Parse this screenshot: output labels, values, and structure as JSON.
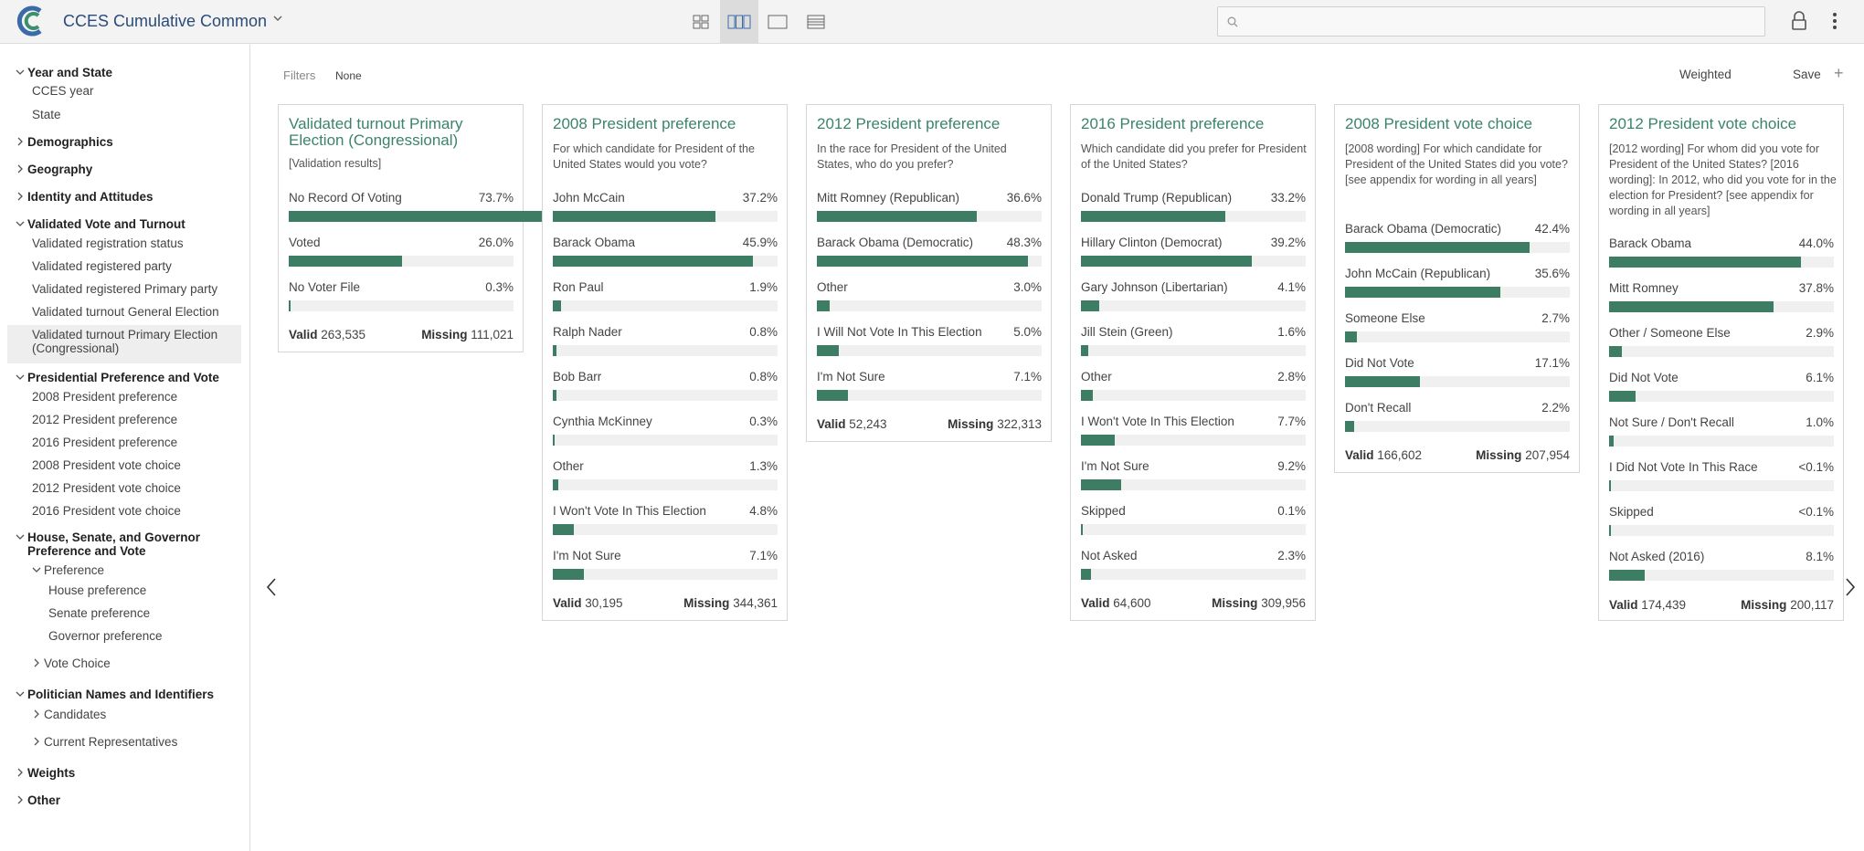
{
  "app": {
    "title": "CCES Cumulative Common"
  },
  "search": {
    "placeholder": ""
  },
  "sidebar": {
    "rows": [
      {
        "label": "Year and State",
        "kind": "group",
        "open": true
      },
      {
        "label": "CCES year",
        "kind": "leaf"
      },
      {
        "label": "State",
        "kind": "leaf"
      },
      {
        "label": "Demographics",
        "kind": "group",
        "open": false
      },
      {
        "label": "Geography",
        "kind": "group",
        "open": false
      },
      {
        "label": "Identity and Attitudes",
        "kind": "group",
        "open": false
      },
      {
        "label": "Validated Vote and Turnout",
        "kind": "group",
        "open": true
      },
      {
        "label": "Validated registration status",
        "kind": "leaf"
      },
      {
        "label": "Validated registered party",
        "kind": "leaf"
      },
      {
        "label": "Validated registered Primary party",
        "kind": "leaf"
      },
      {
        "label": "Validated turnout General Election",
        "kind": "leaf"
      },
      {
        "label": "Validated turnout Primary Election (Congressional)",
        "kind": "leaf",
        "selected": true
      },
      {
        "label": "Presidential Preference and Vote",
        "kind": "group",
        "open": true
      },
      {
        "label": "2008 President preference",
        "kind": "leaf"
      },
      {
        "label": "2012 President preference",
        "kind": "leaf"
      },
      {
        "label": "2016 President preference",
        "kind": "leaf"
      },
      {
        "label": "2008 President vote choice",
        "kind": "leaf"
      },
      {
        "label": "2012 President vote choice",
        "kind": "leaf"
      },
      {
        "label": "2016 President vote choice",
        "kind": "leaf"
      },
      {
        "label": "House, Senate, and Governor Preference and Vote",
        "kind": "group",
        "open": true
      },
      {
        "label": "Preference",
        "kind": "subgroup",
        "open": true
      },
      {
        "label": "House preference",
        "kind": "subleaf"
      },
      {
        "label": "Senate preference",
        "kind": "subleaf"
      },
      {
        "label": "Governor preference",
        "kind": "subleaf"
      },
      {
        "label": "Vote Choice",
        "kind": "subgroup",
        "open": false
      },
      {
        "label": "Politician Names and Identifiers",
        "kind": "group",
        "open": true
      },
      {
        "label": "Candidates",
        "kind": "subgroup",
        "open": false
      },
      {
        "label": "Current Representatives",
        "kind": "subgroup",
        "open": false
      },
      {
        "label": "Weights",
        "kind": "group",
        "open": false
      },
      {
        "label": "Other",
        "kind": "group",
        "open": false
      }
    ]
  },
  "toolbar": {
    "filters_label": "Filters",
    "filters_value": "None",
    "weighted_label": "Weighted",
    "save_label": "Save",
    "add_symbol": "+"
  },
  "colors": {
    "bar": "#3c7d63",
    "title": "#3b8469",
    "track": "#f0f0f0"
  },
  "cards": [
    {
      "title": "Validated turnout Primary Election (Congressional)",
      "subtitle": "[Validation results]",
      "categories": [
        {
          "label": "No Record Of Voting",
          "pct": "73.7%",
          "value": 73.7
        },
        {
          "label": "Voted",
          "pct": "26.0%",
          "value": 26.0
        },
        {
          "label": "No Voter File",
          "pct": "0.3%",
          "value": 0.3
        }
      ],
      "valid_label": "Valid",
      "valid": "263,535",
      "missing_label": "Missing",
      "missing": "111,021"
    },
    {
      "title": "2008 President preference",
      "subtitle": "For which candidate for President of the United States would you vote?",
      "categories": [
        {
          "label": "John McCain",
          "pct": "37.2%",
          "value": 37.2
        },
        {
          "label": "Barack Obama",
          "pct": "45.9%",
          "value": 45.9
        },
        {
          "label": "Ron Paul",
          "pct": "1.9%",
          "value": 1.9
        },
        {
          "label": "Ralph Nader",
          "pct": "0.8%",
          "value": 0.8
        },
        {
          "label": "Bob Barr",
          "pct": "0.8%",
          "value": 0.8
        },
        {
          "label": "Cynthia McKinney",
          "pct": "0.3%",
          "value": 0.3
        },
        {
          "label": "Other",
          "pct": "1.3%",
          "value": 1.3
        },
        {
          "label": "I Won't Vote In This Election",
          "pct": "4.8%",
          "value": 4.8
        },
        {
          "label": "I'm Not Sure",
          "pct": "7.1%",
          "value": 7.1
        }
      ],
      "valid_label": "Valid",
      "valid": "30,195",
      "missing_label": "Missing",
      "missing": "344,361"
    },
    {
      "title": "2012 President preference",
      "subtitle": "In the race for President of the United States, who do you prefer?",
      "categories": [
        {
          "label": "Mitt Romney (Republican)",
          "pct": "36.6%",
          "value": 36.6
        },
        {
          "label": "Barack Obama (Democratic)",
          "pct": "48.3%",
          "value": 48.3
        },
        {
          "label": "Other",
          "pct": "3.0%",
          "value": 3.0
        },
        {
          "label": "I Will Not Vote In This Election",
          "pct": "5.0%",
          "value": 5.0
        },
        {
          "label": "I'm Not Sure",
          "pct": "7.1%",
          "value": 7.1
        }
      ],
      "valid_label": "Valid",
      "valid": "52,243",
      "missing_label": "Missing",
      "missing": "322,313"
    },
    {
      "title": "2016 President preference",
      "subtitle": "Which candidate did you prefer for President of the United States?",
      "categories": [
        {
          "label": "Donald Trump (Republican)",
          "pct": "33.2%",
          "value": 33.2
        },
        {
          "label": "Hillary Clinton (Democrat)",
          "pct": "39.2%",
          "value": 39.2
        },
        {
          "label": "Gary Johnson (Libertarian)",
          "pct": "4.1%",
          "value": 4.1
        },
        {
          "label": "Jill Stein (Green)",
          "pct": "1.6%",
          "value": 1.6
        },
        {
          "label": "Other",
          "pct": "2.8%",
          "value": 2.8
        },
        {
          "label": "I Won't Vote In This Election",
          "pct": "7.7%",
          "value": 7.7
        },
        {
          "label": "I'm Not Sure",
          "pct": "9.2%",
          "value": 9.2
        },
        {
          "label": "Skipped",
          "pct": "0.1%",
          "value": 0.1
        },
        {
          "label": "Not Asked",
          "pct": "2.3%",
          "value": 2.3
        }
      ],
      "valid_label": "Valid",
      "valid": "64,600",
      "missing_label": "Missing",
      "missing": "309,956"
    },
    {
      "title": "2008 President vote choice",
      "subtitle": "[2008 wording] For which candidate for President of the United States did you vote? [see appendix for wording in all years]",
      "categories": [
        {
          "label": "Barack Obama (Democratic)",
          "pct": "42.4%",
          "value": 42.4
        },
        {
          "label": "John McCain (Republican)",
          "pct": "35.6%",
          "value": 35.6
        },
        {
          "label": "Someone Else",
          "pct": "2.7%",
          "value": 2.7
        },
        {
          "label": "Did Not Vote",
          "pct": "17.1%",
          "value": 17.1
        },
        {
          "label": "Don't Recall",
          "pct": "2.2%",
          "value": 2.2
        }
      ],
      "valid_label": "Valid",
      "valid": "166,602",
      "missing_label": "Missing",
      "missing": "207,954"
    },
    {
      "title": "2012 President vote choice",
      "subtitle": "[2012 wording] For whom did you vote for President of the United States? [2016 wording]: In 2012, who did you vote for in the election for President? [see appendix for wording in all years]",
      "categories": [
        {
          "label": "Barack Obama",
          "pct": "44.0%",
          "value": 44.0
        },
        {
          "label": "Mitt Romney",
          "pct": "37.8%",
          "value": 37.8
        },
        {
          "label": "Other / Someone Else",
          "pct": "2.9%",
          "value": 2.9
        },
        {
          "label": "Did Not Vote",
          "pct": "6.1%",
          "value": 6.1
        },
        {
          "label": "Not Sure / Don't Recall",
          "pct": "1.0%",
          "value": 1.0
        },
        {
          "label": "I Did Not Vote In This Race",
          "pct": "<0.1%",
          "value": 0.05
        },
        {
          "label": "Skipped",
          "pct": "<0.1%",
          "value": 0.05
        },
        {
          "label": "Not Asked (2016)",
          "pct": "8.1%",
          "value": 8.1
        }
      ],
      "valid_label": "Valid",
      "valid": "174,439",
      "missing_label": "Missing",
      "missing": "200,117"
    }
  ]
}
